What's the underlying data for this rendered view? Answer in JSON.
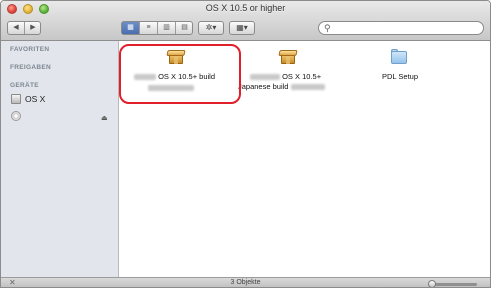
{
  "window": {
    "title": "OS X 10.5 or higher"
  },
  "toolbar": {
    "search_placeholder": ""
  },
  "sidebar": {
    "sections": [
      {
        "heading": "FAVORITEN"
      },
      {
        "heading": "FREIGABEN"
      },
      {
        "heading": "GERÄTE"
      }
    ],
    "devices": [
      {
        "label": "OS X",
        "icon": "hard-disk-icon"
      },
      {
        "label": "",
        "icon": "optical-disc-icon"
      }
    ]
  },
  "files": [
    {
      "name": "OS X 10.5+ build",
      "icon": "package-icon",
      "highlighted": true
    },
    {
      "name": "OS X 10.5+",
      "subname": "Japanese build",
      "icon": "package-icon",
      "highlighted": false
    },
    {
      "name": "PDL Setup",
      "icon": "folder-icon",
      "highlighted": false
    }
  ],
  "statusbar": {
    "text": "3 Objekte"
  },
  "colors": {
    "highlight": "#e0202a",
    "sidebar": "#e2e6ec"
  }
}
